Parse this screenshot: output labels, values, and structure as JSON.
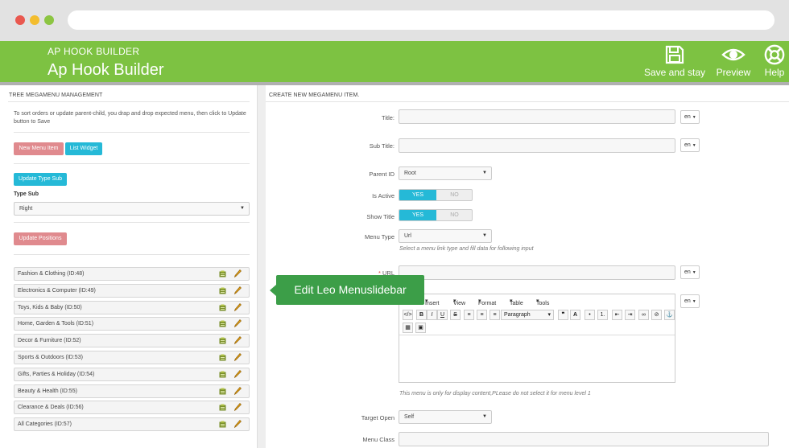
{
  "header": {
    "small_title": "AP HOOK BUILDER",
    "big_title": "Ap Hook Builder",
    "toolbar": [
      {
        "label": "Save and stay",
        "icon": "floppy-disk-icon"
      },
      {
        "label": "Preview",
        "icon": "eye-icon"
      },
      {
        "label": "Help",
        "icon": "lifebuoy-icon"
      }
    ]
  },
  "left": {
    "title": "TREE MEGAMENU MANAGEMENT",
    "help": "To sort orders or update parent-child, you drap and drop expected menu, then click to Update button to Save",
    "btn_new_menu": "New Menu Item",
    "btn_list_widget": "List Widget",
    "btn_update_type_sub": "Update Type Sub",
    "type_sub_label": "Type Sub",
    "type_sub_value": "Right",
    "btn_update_positions": "Update Positions",
    "items": [
      "Fashion & Clothing (ID:48)",
      "Electronics & Computer (ID:49)",
      "Toys, Kids & Baby (ID:50)",
      "Home, Garden & Tools (ID:51)",
      "Decor & Furniture (ID:52)",
      "Sports & Outdoors (ID:53)",
      "Gifts, Parties & Holiday (ID:54)",
      "Beauty & Health (ID:55)",
      "Clearance & Deals (ID:56)",
      "All Categories (ID:57)"
    ]
  },
  "tooltip": "Edit Leo Menuslidebar",
  "right": {
    "title": "CREATE NEW MEGAMENU ITEM.",
    "fields": {
      "title_label": "Title:",
      "subtitle_label": "Sub Title:",
      "parent_id_label": "Parent ID",
      "parent_id_value": "Root",
      "is_active_label": "Is Active",
      "show_title_label": "Show Title",
      "menu_type_label": "Menu Type",
      "menu_type_value": "Url",
      "menu_type_hint": "Select a menu link type and fill data for following input",
      "url_label": "URL",
      "content_hint": "This menu is only for display content,PLease do not select it for menu level 1",
      "target_open_label": "Target Open",
      "target_open_value": "Self",
      "menu_class_label": "Menu Class"
    },
    "lang": "en",
    "yes": "YES",
    "no": "NO",
    "editor": {
      "menus": [
        "Insert",
        "View",
        "Format",
        "Table",
        "Tools"
      ],
      "paragraph": "Paragraph"
    }
  }
}
